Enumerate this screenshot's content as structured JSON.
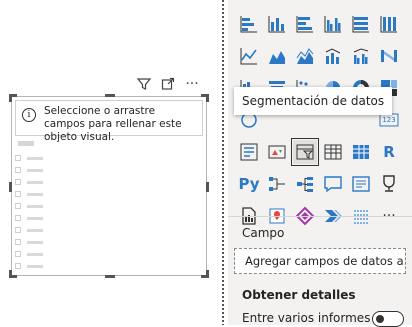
{
  "visual": {
    "placeholder_text": "Seleccione o arrastre campos para rellenar este objeto visual."
  },
  "visual_header": {
    "filter_icon": "filter-icon",
    "focus_icon": "focus-mode-icon",
    "more_icon": "more-options-icon",
    "more_glyph": "···"
  },
  "visualizations": {
    "tooltip": "Segmentación de datos",
    "more_glyph": "···",
    "r_label": "R",
    "py_label": "Py",
    "table_123_label": "123"
  },
  "fields": {
    "campo_label": "Campo",
    "well_placeholder": "Agregar campos de datos a..."
  },
  "drillthrough": {
    "title": "Obtener detalles",
    "cross_report_label": "Entre varios informes",
    "cross_report_state": "off"
  },
  "colors": {
    "accent_blue": "#2b78c5",
    "accent_teal": "#118dff",
    "panel_bg": "#f3f2f1"
  }
}
